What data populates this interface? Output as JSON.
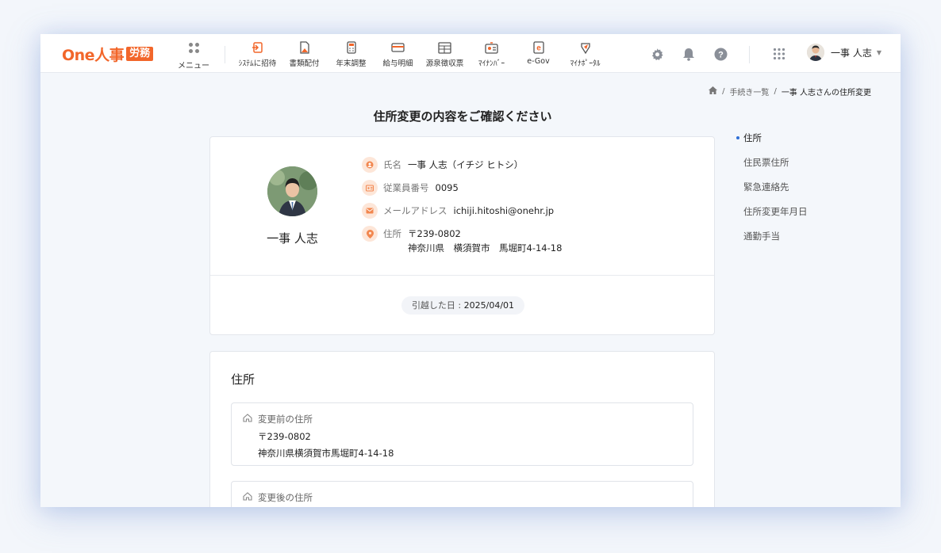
{
  "app": {
    "logo_text": "One人事",
    "logo_badge": "労務",
    "menu_label": "メニュー"
  },
  "nav": [
    {
      "label": "ｼｽﾃﾑに招待",
      "icon": "invite-icon"
    },
    {
      "label": "書類配付",
      "icon": "document-send-icon"
    },
    {
      "label": "年末調整",
      "icon": "calculator-icon"
    },
    {
      "label": "給与明細",
      "icon": "payslip-icon"
    },
    {
      "label": "源泉徴収票",
      "icon": "withholding-slip-icon"
    },
    {
      "label": "ﾏｲﾅﾝﾊﾞｰ",
      "icon": "my-number-card-icon"
    },
    {
      "label": "e-Gov",
      "icon": "egov-icon"
    },
    {
      "label": "ﾏｲﾅﾎﾟｰﾀﾙ",
      "icon": "myna-portal-icon"
    }
  ],
  "header_icons": [
    "gear-icon",
    "bell-icon",
    "help-icon",
    "apps-grid-icon"
  ],
  "user": {
    "name": "一事 人志"
  },
  "breadcrumb": {
    "item1": "手続き一覧",
    "sep": "/",
    "current": "一事 人志さんの住所変更"
  },
  "page_title": "住所変更の内容をご確認ください",
  "profile": {
    "display_name": "一事 人志",
    "name_label": "氏名",
    "name_value": "一事 人志（イチジ ヒトシ）",
    "emp_label": "従業員番号",
    "emp_value": "0095",
    "email_label": "メールアドレス",
    "email_value": "ichiji.hitoshi@onehr.jp",
    "addr_label": "住所",
    "addr_postal": "〒239-0802",
    "addr_line": "神奈川県　横須賀市　馬堀町4-14-18",
    "moving_label": "引越した日 : ",
    "moving_date": "2025/04/01"
  },
  "address_section": {
    "heading": "住所",
    "before_title": "変更前の住所",
    "before_postal": "〒239-0802",
    "before_line": "神奈川県横須賀市馬堀町4-14-18",
    "after_title": "変更後の住所"
  },
  "toc": [
    "住所",
    "住民票住所",
    "緊急連絡先",
    "住所変更年月日",
    "通勤手当"
  ],
  "colors": {
    "brand": "#f2662a",
    "accent_dot": "#2f6fd6"
  }
}
